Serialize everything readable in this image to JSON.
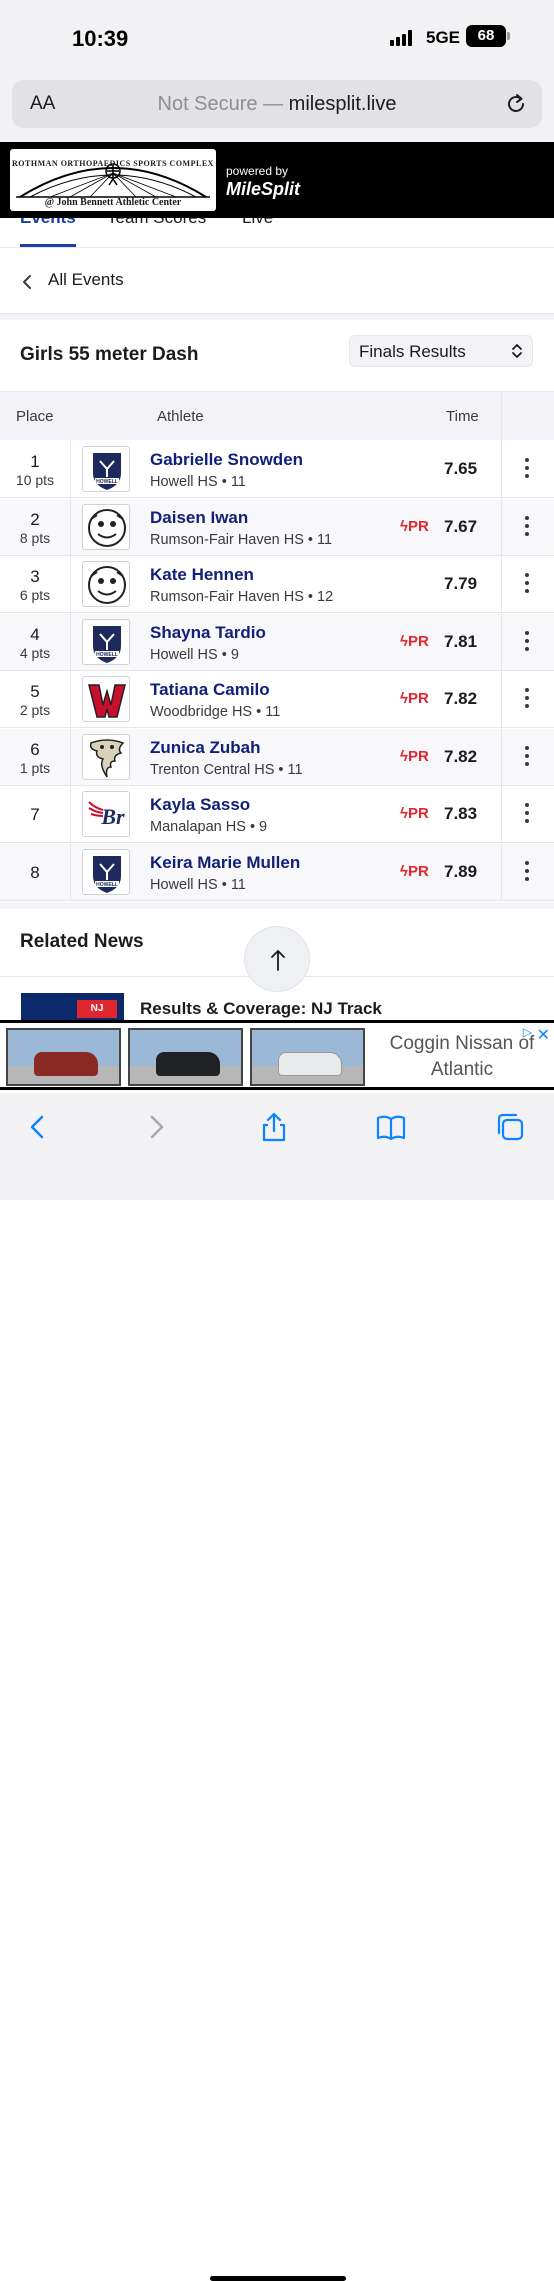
{
  "status_bar": {
    "time": "10:39",
    "network": "5GE",
    "battery": "68"
  },
  "browser": {
    "text_size": "AA",
    "not_secure": "Not Secure —",
    "domain": "milesplit.live"
  },
  "banner": {
    "logo_line1": "ROTHMAN ORTHOPAEDICS SPORTS COMPLEX",
    "logo_line2": "@ John Bennett Athletic Center",
    "powered_by": "powered by",
    "brand": "MileSplit"
  },
  "tabs": [
    {
      "label": "Events"
    },
    {
      "label": "Team Scores"
    },
    {
      "label": "Live"
    }
  ],
  "nav": {
    "back_label": "All Events"
  },
  "event": {
    "title": "Girls 55 meter Dash",
    "round_select": "Finals Results"
  },
  "table": {
    "headers": {
      "place": "Place",
      "athlete": "Athlete",
      "time": "Time"
    },
    "rows": [
      {
        "place": "1",
        "pts": "10 pts",
        "name": "Gabrielle Snowden",
        "school": "Howell HS • 11",
        "pr": "",
        "time": "7.65",
        "logo": "howell"
      },
      {
        "place": "2",
        "pts": "8 pts",
        "name": "Daisen Iwan",
        "school": "Rumson-Fair Haven HS • 11",
        "pr": "PR",
        "time": "7.67",
        "logo": "rumson"
      },
      {
        "place": "3",
        "pts": "6 pts",
        "name": "Kate Hennen",
        "school": "Rumson-Fair Haven HS • 12",
        "pr": "",
        "time": "7.79",
        "logo": "rumson"
      },
      {
        "place": "4",
        "pts": "4 pts",
        "name": "Shayna Tardio",
        "school": "Howell HS • 9",
        "pr": "PR",
        "time": "7.81",
        "logo": "howell"
      },
      {
        "place": "5",
        "pts": "2 pts",
        "name": "Tatiana Camilo",
        "school": "Woodbridge HS • 11",
        "pr": "PR",
        "time": "7.82",
        "logo": "woodbridge"
      },
      {
        "place": "6",
        "pts": "1 pts",
        "name": "Zunica Zubah",
        "school": "Trenton Central HS • 11",
        "pr": "PR",
        "time": "7.82",
        "logo": "trenton"
      },
      {
        "place": "7",
        "pts": "",
        "name": "Kayla Sasso",
        "school": "Manalapan HS • 9",
        "pr": "PR",
        "time": "7.83",
        "logo": "manalapan"
      },
      {
        "place": "8",
        "pts": "",
        "name": "Keira Marie Mullen",
        "school": "Howell HS • 11",
        "pr": "PR",
        "time": "7.89",
        "logo": "howell"
      }
    ]
  },
  "related": {
    "heading": "Related News",
    "first_title": "Results & Coverage: NJ Track"
  },
  "ad": {
    "line1": "Coggin Nissan of",
    "line2": "Atlantic"
  },
  "colors": {
    "accent": "#1b3fa3",
    "athlete_name": "#12207a",
    "pr_red": "#e0262e"
  }
}
